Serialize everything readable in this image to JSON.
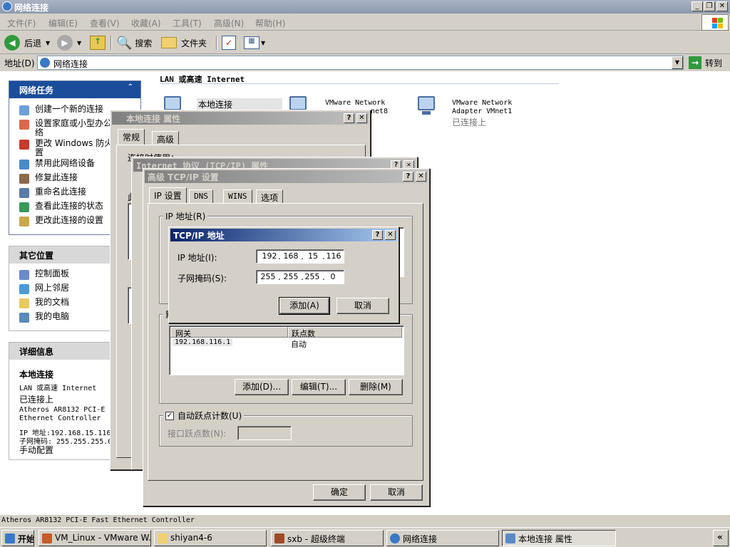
{
  "window": {
    "title": "网络连接"
  },
  "menu": [
    "文件(F)",
    "编辑(E)",
    "查看(V)",
    "收藏(A)",
    "工具(T)",
    "高级(N)",
    "帮助(H)"
  ],
  "toolbar": {
    "back": "后退",
    "search": "搜索",
    "folders": "文件夹"
  },
  "address": {
    "label": "地址(D)",
    "value": "网络连接",
    "go": "转到"
  },
  "section_header": "LAN 或高速 Internet",
  "connections": [
    {
      "name": "本地连接",
      "line2": ""
    },
    {
      "name": "VMware Network",
      "line2": "net8"
    },
    {
      "name": "VMware Network",
      "line2": "Adapter VMnet1",
      "status": "已连接上"
    }
  ],
  "network_tasks": {
    "title": "网络任务",
    "items": [
      "创建一个新的连接",
      "设置家庭或小型办公",
      "络",
      "更改 Windows 防火",
      "置",
      "禁用此网络设备",
      "修复此连接",
      "重命名此连接",
      "查看此连接的状态",
      "更改此连接的设置"
    ]
  },
  "other_places": {
    "title": "其它位置",
    "items": [
      "控制面板",
      "网上邻居",
      "我的文档",
      "我的电脑"
    ]
  },
  "details": {
    "title": "详细信息",
    "name": "本地连接",
    "type": "LAN 或高速 Internet",
    "status": "已连接上",
    "adapter": "Atheros AR8132 PCI-E Fast Ethernet Controller",
    "ip": "IP 地址:192.168.15.116",
    "mask": "子网掩码: 255.255.255.0",
    "config": "手动配置"
  },
  "dialog_local": {
    "title": "本地连接 属性",
    "tabs": [
      "常规",
      "高级"
    ],
    "partial_text": "连接时使用：",
    "partial_label": "此"
  },
  "dialog_tcpip": {
    "title": "Internet 协议 (TCP/IP) 属性"
  },
  "dialog_advanced": {
    "title": "高级 TCP/IP 设置",
    "tabs": [
      "IP 设置",
      "DNS",
      "WINS",
      "选项"
    ],
    "ip_group": "IP 地址(R)",
    "gateway_group_label": "默",
    "gateway_headers": [
      "网关",
      "跃点数"
    ],
    "gateway_rows": [
      [
        "192.168.116.1",
        "自动"
      ]
    ],
    "add": "添加(D)...",
    "edit": "编辑(T)...",
    "delete": "删除(M)",
    "auto_metric": "自动跃点计数(U)",
    "interface_metric": "接口跃点数(N):",
    "ok": "确定",
    "cancel": "取消"
  },
  "dialog_ipaddr": {
    "title": "TCP/IP 地址",
    "ip_label": "IP 地址(I):",
    "mask_label": "子网掩码(S):",
    "ip": [
      "192",
      "168",
      "15",
      "116"
    ],
    "mask": [
      "255",
      "255",
      "255",
      "0"
    ],
    "add": "添加(A)",
    "cancel": "取消"
  },
  "statusbar": "Atheros AR8132 PCI-E Fast Ethernet Controller",
  "taskbar": {
    "start": "开始",
    "items": [
      "VM_Linux - VMware W...",
      "shiyan4-6",
      "sxb - 超级终端",
      "网络连接",
      "本地连接 属性"
    ]
  },
  "colors": {
    "task_header": "#1a4d9a",
    "active_title": "#0a246a"
  }
}
